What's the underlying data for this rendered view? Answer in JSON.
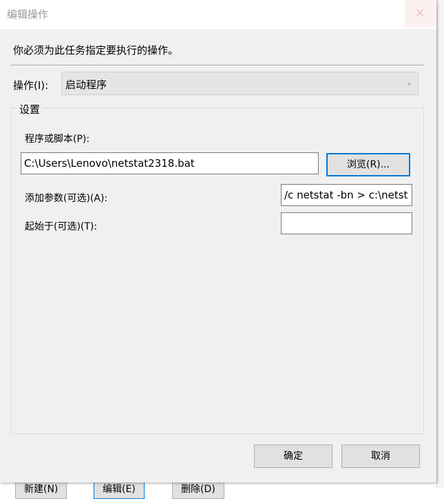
{
  "background": {
    "buttons": [
      "新建(N)",
      "编辑(E)",
      "删除(D)"
    ]
  },
  "dialog": {
    "title": "编辑操作",
    "close_icon": "close-icon",
    "instruction": "你必须为此任务指定要执行的操作。",
    "action_label": "操作(I):",
    "action_value": "启动程序",
    "settings_label": "设置",
    "program_label": "程序或脚本(P):",
    "program_value": "C:\\Users\\Lenovo\\netstat2318.bat",
    "browse_label": "浏览(R)...",
    "args_label": "添加参数(可选)(A):",
    "args_value": "/c netstat -bn > c:\\netst",
    "start_label": "起始于(可选)(T):",
    "start_value": "",
    "ok_label": "确定",
    "cancel_label": "取消"
  }
}
